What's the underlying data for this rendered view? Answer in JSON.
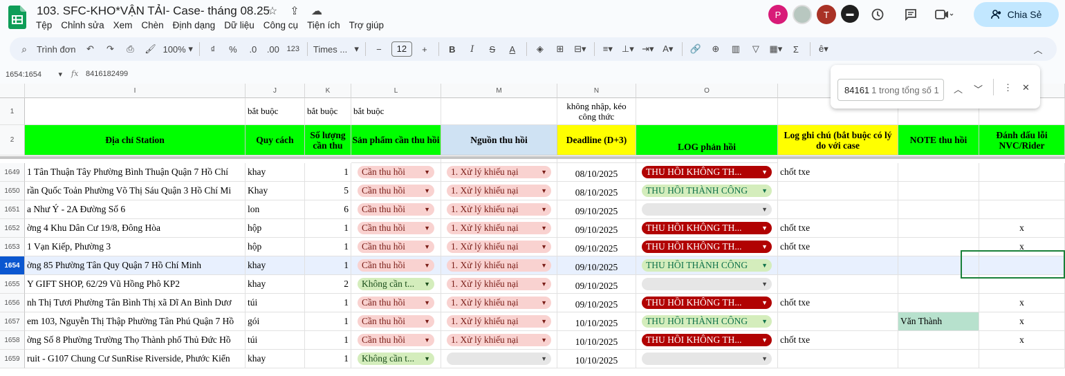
{
  "app": {
    "title": "103. SFC-KHO*VẬN TẢI- Case- tháng 08.25"
  },
  "menu": [
    "Tệp",
    "Chỉnh sửa",
    "Xem",
    "Chèn",
    "Định dạng",
    "Dữ liệu",
    "Công cụ",
    "Tiện ích",
    "Trợ giúp"
  ],
  "avatars": [
    {
      "letter": "P",
      "color": "#d81b78"
    },
    {
      "letter": "",
      "color": "#b8c7c0"
    },
    {
      "letter": "T",
      "color": "#a93226"
    }
  ],
  "share_label": "Chia Sẻ",
  "toolbar": {
    "search": "Trình đơn",
    "zoom": "100%",
    "currency": "₫",
    "percent": "%",
    "dec_dec": ".0",
    "dec_inc": ".00",
    "format123": "123",
    "font": "Times ...",
    "font_size": "12"
  },
  "formula": {
    "cell_ref": "1654:1654",
    "fx": "fx",
    "value": "8416182499"
  },
  "columns": [
    {
      "id": "I"
    },
    {
      "id": "J"
    },
    {
      "id": "K"
    },
    {
      "id": "L"
    },
    {
      "id": "M"
    },
    {
      "id": "N"
    },
    {
      "id": "O"
    },
    {
      "id": ""
    },
    {
      "id": ""
    },
    {
      "id": ""
    }
  ],
  "header_row1": {
    "row": "1",
    "J": "bắt buộc",
    "K": "bắt buộc",
    "L": "bắt buộc",
    "N": "không nhập, kéo công thức"
  },
  "header_row2": {
    "row": "2",
    "I": "Địa chỉ Station",
    "J": "Quy cách",
    "K": "Số lượng cần thu",
    "L": "Sản phẩm cần thu hồi",
    "M": "Nguồn thu hồi",
    "N": "Deadline (D+3)",
    "O": "LOG phản hồi",
    "P": "Log ghi chú (bắt buộc có lý do với case",
    "Q": "NOTE thu hồi",
    "R": "Đánh dấu lỗi NVC/Rider"
  },
  "rows": [
    {
      "row": "1649",
      "I": "1 Tân Thuận Tây Phường Bình Thuận Quận 7 Hồ Chí",
      "J": "khay",
      "K": "1",
      "L": "Cần thu hồi",
      "M": "1. Xử lý khiếu nại",
      "N": "08/10/2025",
      "O": "THU HỒI KHÔNG TH...",
      "P": "chốt txe",
      "Q": "",
      "R": ""
    },
    {
      "row": "1650",
      "I": "rần Quốc Toản Phường Võ Thị Sáu Quận 3 Hồ Chí Mi",
      "J": "Khay",
      "K": "5",
      "L": "Cần thu hồi",
      "M": "1. Xử lý khiếu nại",
      "N": "08/10/2025",
      "O": "THU HỒI THÀNH CÔNG",
      "P": "",
      "Q": "",
      "R": ""
    },
    {
      "row": "1651",
      "I": "a Như Ý - 2A Đường Số 6",
      "J": "lon",
      "K": "6",
      "L": "Cần thu hồi",
      "M": "1. Xử lý khiếu nại",
      "N": "09/10/2025",
      "O": "",
      "P": "",
      "Q": "",
      "R": ""
    },
    {
      "row": "1652",
      "I": "ờng 4 Khu Dân Cư 19/8, Đông Hòa",
      "J": "hộp",
      "K": "1",
      "L": "Cần thu hồi",
      "M": "1. Xử lý khiếu nại",
      "N": "09/10/2025",
      "O": "THU HỒI KHÔNG TH...",
      "P": "chốt txe",
      "Q": "",
      "R": "x"
    },
    {
      "row": "1653",
      "I": "1 Vạn Kiếp, Phường 3",
      "J": "hộp",
      "K": "1",
      "L": "Cần thu hồi",
      "M": "1. Xử lý khiếu nại",
      "N": "09/10/2025",
      "O": "THU HỒI KHÔNG TH...",
      "P": "chốt txe",
      "Q": "",
      "R": "x"
    },
    {
      "row": "1654",
      "I": "ờng 85 Phường Tân Quy Quận 7 Hồ Chí Minh",
      "J": "khay",
      "K": "1",
      "L": "Cần thu hồi",
      "M": "1. Xử lý khiếu nại",
      "N": "09/10/2025",
      "O": "THU HỒI THÀNH CÔNG",
      "P": "",
      "Q": "",
      "R": ""
    },
    {
      "row": "1655",
      "I": "Y GIFT SHOP, 62/29 Vũ Hồng Phô KP2",
      "J": "khay",
      "K": "2",
      "L": "Không cần t...",
      "M": "1. Xử lý khiếu nại",
      "N": "09/10/2025",
      "O": "",
      "P": "",
      "Q": "",
      "R": ""
    },
    {
      "row": "1656",
      "I": "nh Thị Tươi Phường Tân Bình Thị xã Dĩ An Bình Dươ",
      "J": "túi",
      "K": "1",
      "L": "Cần thu hồi",
      "M": "1. Xử lý khiếu nại",
      "N": "09/10/2025",
      "O": "THU HỒI KHÔNG TH...",
      "P": "chốt txe",
      "Q": "",
      "R": "x"
    },
    {
      "row": "1657",
      "I": "em 103, Nguyễn Thị Thập Phường Tân Phú Quận 7 Hồ",
      "J": "gói",
      "K": "1",
      "L": "Cần thu hồi",
      "M": "1. Xử lý khiếu nại",
      "N": "10/10/2025",
      "O": "THU HỒI THÀNH CÔNG",
      "P": "",
      "Q": "Văn Thành",
      "R": "x"
    },
    {
      "row": "1658",
      "I": "ờng Số 8 Phường Trường Thọ Thành phố Thủ Đức Hồ",
      "J": "túi",
      "K": "1",
      "L": "Cần thu hồi",
      "M": "1. Xử lý khiếu nại",
      "N": "10/10/2025",
      "O": "THU HỒI KHÔNG TH...",
      "P": "chốt txe",
      "Q": "",
      "R": "x"
    },
    {
      "row": "1659",
      "I": "ruit - G107 Chung Cư SunRise Riverside, Phước Kiển",
      "J": "khay",
      "K": "1",
      "L": "Không cần t...",
      "M": "",
      "N": "10/10/2025",
      "O": "",
      "P": "",
      "Q": "",
      "R": ""
    }
  ],
  "partial_top": {
    "L": "Cần thu hồi",
    "M": "1. Xử lý khiếu nại",
    "N": "08/10/2025",
    "O": "THU HỒI THÀNH CÔNG"
  },
  "find": {
    "query": "84161",
    "count": "1 trong tổng số 1"
  }
}
